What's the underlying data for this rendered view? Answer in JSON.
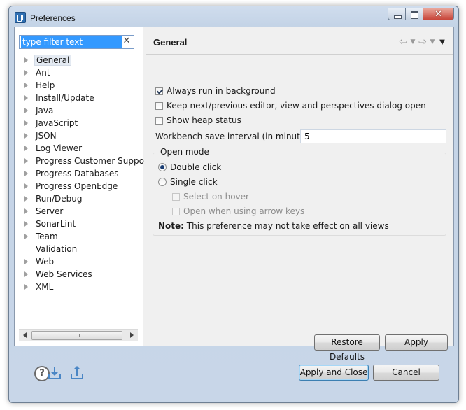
{
  "window": {
    "title": "Preferences"
  },
  "filter": {
    "value": "type filter text",
    "clear_symbol": "✕"
  },
  "tree": [
    {
      "label": "General",
      "expandable": true,
      "selected": true
    },
    {
      "label": "Ant",
      "expandable": true
    },
    {
      "label": "Help",
      "expandable": true
    },
    {
      "label": "Install/Update",
      "expandable": true
    },
    {
      "label": "Java",
      "expandable": true
    },
    {
      "label": "JavaScript",
      "expandable": true
    },
    {
      "label": "JSON",
      "expandable": true
    },
    {
      "label": "Log Viewer",
      "expandable": true
    },
    {
      "label": "Progress Customer Support",
      "expandable": true
    },
    {
      "label": "Progress Databases",
      "expandable": true
    },
    {
      "label": "Progress OpenEdge",
      "expandable": true
    },
    {
      "label": "Run/Debug",
      "expandable": true
    },
    {
      "label": "Server",
      "expandable": true
    },
    {
      "label": "SonarLint",
      "expandable": true
    },
    {
      "label": "Team",
      "expandable": true
    },
    {
      "label": "Validation",
      "expandable": false
    },
    {
      "label": "Web",
      "expandable": true
    },
    {
      "label": "Web Services",
      "expandable": true
    },
    {
      "label": "XML",
      "expandable": true
    }
  ],
  "page": {
    "title": "General",
    "always_run_in_background": {
      "label": "Always run in background",
      "checked": true
    },
    "keep_next_previous": {
      "label": "Keep next/previous editor, view and perspectives dialog open",
      "checked": false
    },
    "show_heap_status": {
      "label": "Show heap status",
      "checked": false
    },
    "save_interval": {
      "label": "Workbench save interval (in minutes):",
      "value": "5"
    },
    "open_mode": {
      "title": "Open mode",
      "double_click": {
        "label": "Double click",
        "selected": true
      },
      "single_click": {
        "label": "Single click",
        "selected": false
      },
      "select_on_hover": {
        "label": "Select on hover",
        "checked": false,
        "enabled": false
      },
      "open_arrow_keys": {
        "label": "Open when using arrow keys",
        "checked": false,
        "enabled": false
      },
      "note_label": "Note:",
      "note_text": "This preference may not take effect on all views"
    },
    "restore_defaults": "Restore Defaults",
    "apply": "Apply"
  },
  "footer": {
    "apply_and_close": "Apply and Close",
    "cancel": "Cancel",
    "icons": [
      "help-icon",
      "import-icon",
      "export-icon"
    ]
  }
}
